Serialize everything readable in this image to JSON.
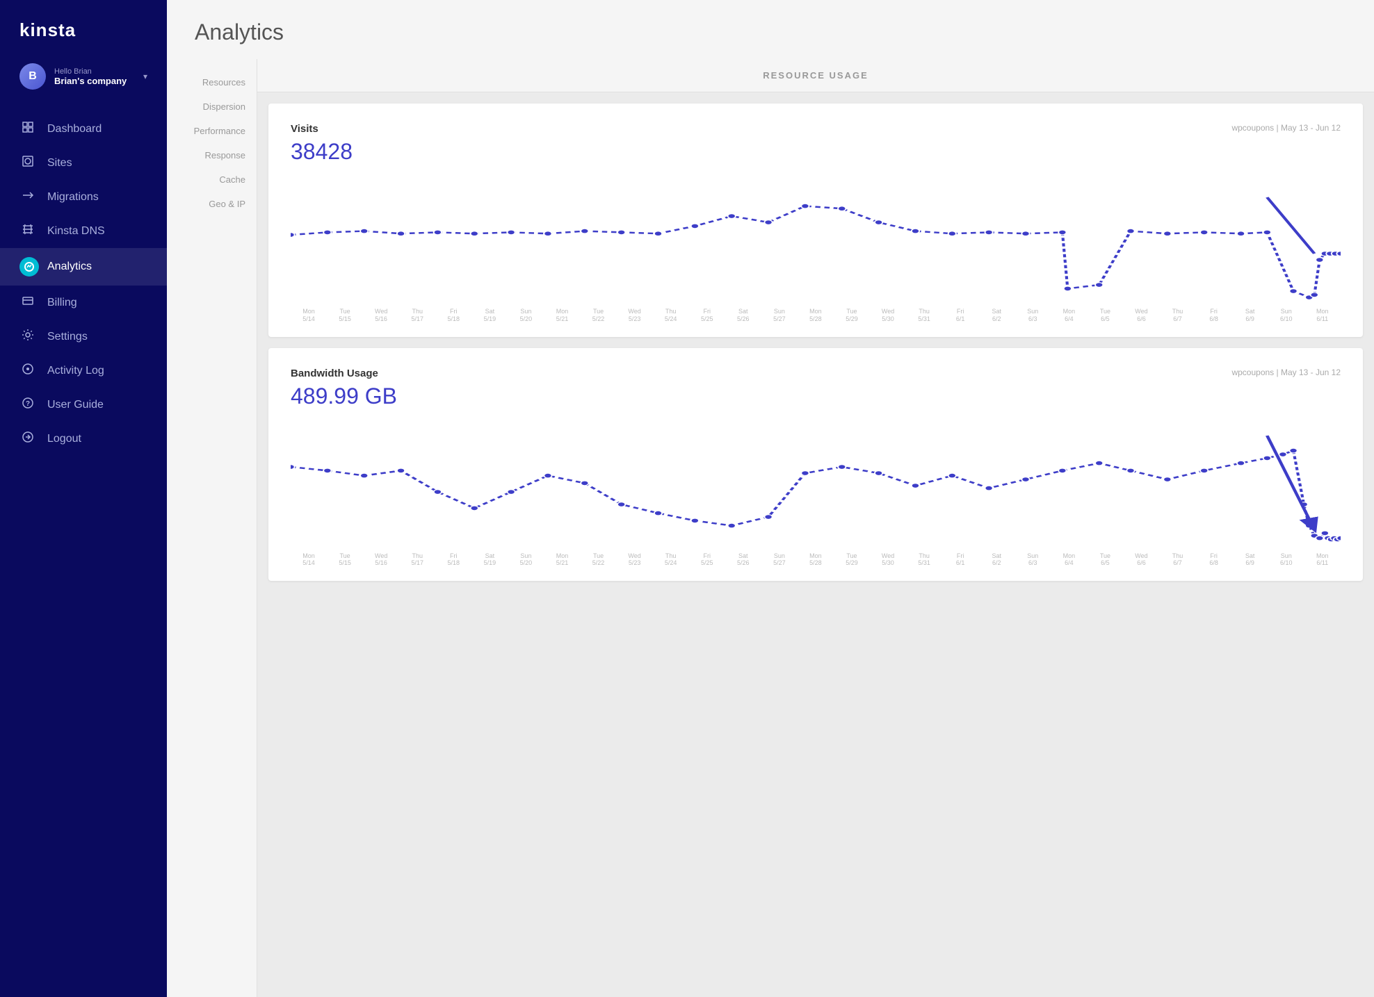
{
  "logo": "kinsta",
  "user": {
    "greeting": "Hello Brian",
    "company": "Brian's company"
  },
  "nav": {
    "items": [
      {
        "id": "dashboard",
        "label": "Dashboard",
        "icon": "⌂"
      },
      {
        "id": "sites",
        "label": "Sites",
        "icon": "◈"
      },
      {
        "id": "migrations",
        "label": "Migrations",
        "icon": "➤"
      },
      {
        "id": "kinsta-dns",
        "label": "Kinsta DNS",
        "icon": "⌇"
      },
      {
        "id": "analytics",
        "label": "Analytics",
        "icon": "◎",
        "active": true
      },
      {
        "id": "billing",
        "label": "Billing",
        "icon": "▬"
      },
      {
        "id": "settings",
        "label": "Settings",
        "icon": "⚙"
      },
      {
        "id": "activity-log",
        "label": "Activity Log",
        "icon": "👁"
      },
      {
        "id": "user-guide",
        "label": "User Guide",
        "icon": "?"
      },
      {
        "id": "logout",
        "label": "Logout",
        "icon": "↩"
      }
    ]
  },
  "page_title": "Analytics",
  "sub_nav": {
    "items": [
      {
        "id": "resources",
        "label": "Resources"
      },
      {
        "id": "dispersion",
        "label": "Dispersion"
      },
      {
        "id": "performance",
        "label": "Performance"
      },
      {
        "id": "response",
        "label": "Response"
      },
      {
        "id": "cache",
        "label": "Cache"
      },
      {
        "id": "geo-ip",
        "label": "Geo & IP"
      }
    ]
  },
  "resource_usage_title": "RESOURCE USAGE",
  "charts": [
    {
      "id": "visits",
      "label": "Visits",
      "value": "38428",
      "meta": "wpcoupons | May 13 - Jun 12",
      "color": "#3d3dc8"
    },
    {
      "id": "bandwidth",
      "label": "Bandwidth Usage",
      "value": "489.99 GB",
      "meta": "wpcoupons | May 13 - Jun 12",
      "color": "#3d3dc8"
    }
  ],
  "date_ticks": [
    "Mon\n5/14",
    "Tue\n5/15",
    "Wed\n5/16",
    "Thu\n5/17",
    "Fri\n5/18",
    "Sat\n5/19",
    "Sun\n5/20",
    "Mon\n5/21",
    "Tue\n5/22",
    "Wed\n5/23",
    "Thu\n5/24",
    "Fri\n5/25",
    "Sat\n5/26",
    "Sun\n5/27",
    "Mon\n5/28",
    "Tue\n5/29",
    "Wed\n5/30",
    "Thu\n5/31",
    "Fri\n6/1",
    "Sat\n6/2",
    "Sun\n6/3",
    "Mon\n6/4",
    "Tue\n6/5",
    "Wed\n6/6",
    "Thu\n6/7",
    "Fri\n6/8",
    "Sat\n6/9",
    "Sun\n6/10",
    "Mon\n6/11"
  ]
}
